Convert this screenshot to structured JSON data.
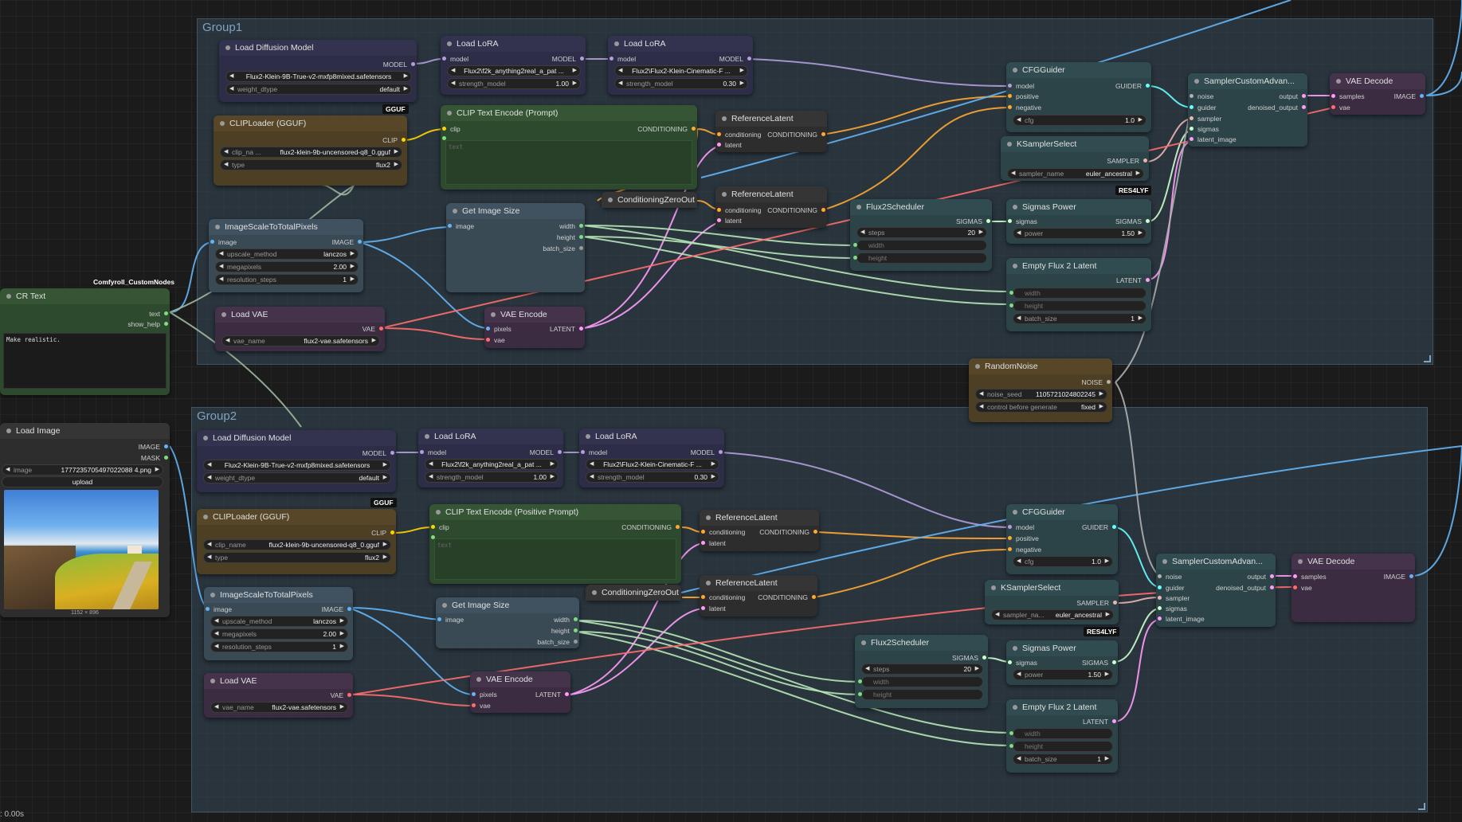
{
  "groups": {
    "g1": "Group1",
    "g2": "Group2"
  },
  "status_text": ": 0.00s",
  "colors": {
    "model": "#b39ddb",
    "clip": "#ffd500",
    "conditioning": "#ffa931",
    "image": "#64b5f6",
    "latent": "#ff9cf9",
    "vae": "#ff6e6e",
    "sigmas": "#cdffcd",
    "noise": "#b0b0b0",
    "guider": "#66ffff",
    "sampler": "#ecb4b4",
    "int": "#b7e6b7"
  },
  "cr_text": {
    "package_label": "Comfyroll_CustomNodes",
    "title": "CR Text",
    "out_text": "text",
    "out_show_help": "show_help",
    "text_value": "Make realistic."
  },
  "load_image": {
    "title": "Load Image",
    "out_image": "IMAGE",
    "out_mask": "MASK",
    "image_label": "image",
    "image_value": "1777235705497022088 4.png",
    "upload_label": "upload",
    "dims": "1152 × 896"
  },
  "g1": {
    "diffusion": {
      "title": "Load Diffusion Model",
      "out": "MODEL",
      "unet": "Flux2-Klein-9B-True-v2-mxfp8mixed.safetensors",
      "dtype_label": "weight_dtype",
      "dtype_value": "default",
      "badge": "GGUF"
    },
    "lora1": {
      "title": "Load LoRA",
      "in": "model",
      "out": "MODEL",
      "name": "Flux2\\f2k_anything2real_a_pat ...",
      "str_label": "strength_model",
      "str_value": "1.00"
    },
    "lora2": {
      "title": "Load LoRA",
      "in": "model",
      "out": "MODEL",
      "name": "Flux2\\Flux2-Klein-Cinematic-F ...",
      "str_label": "strength_model",
      "str_value": "0.30"
    },
    "cliploader": {
      "title": "CLIPLoader (GGUF)",
      "out": "CLIP",
      "name_label": "clip_na ...",
      "name_value": "flux2-klein-9b-uncensored-q8_0.gguf",
      "type_label": "type",
      "type_value": "flux2"
    },
    "clip_encode": {
      "title": "CLIP Text Encode (Prompt)",
      "in_clip": "clip",
      "in_text": "text",
      "out": "CONDITIONING",
      "placeholder": "text"
    },
    "ref1": {
      "title": "ReferenceLatent",
      "in1": "conditioning",
      "in2": "latent",
      "out": "CONDITIONING"
    },
    "ref2": {
      "title": "ReferenceLatent",
      "in1": "conditioning",
      "in2": "latent",
      "out": "CONDITIONING"
    },
    "czo": {
      "title": "ConditioningZeroOut"
    },
    "scale": {
      "title": "ImageScaleToTotalPixels",
      "in": "image",
      "out": "IMAGE",
      "w1l": "upscale_method",
      "w1v": "lanczos",
      "w2l": "megapixels",
      "w2v": "2.00",
      "w3l": "resolution_steps",
      "w3v": "1"
    },
    "imgsize": {
      "title": "Get Image Size",
      "in": "image",
      "o1": "width",
      "o2": "height",
      "o3": "batch_size"
    },
    "loadvae": {
      "title": "Load VAE",
      "out": "VAE",
      "l": "vae_name",
      "v": "flux2-vae.safetensors"
    },
    "vaeenc": {
      "title": "VAE Encode",
      "in1": "pixels",
      "in2": "vae",
      "out": "LATENT"
    },
    "cfg": {
      "title": "CFGGuider",
      "in1": "model",
      "in2": "positive",
      "in3": "negative",
      "out": "GUIDER",
      "l": "cfg",
      "v": "1.0"
    },
    "ksel": {
      "title": "KSamplerSelect",
      "out": "SAMPLER",
      "l": "sampler_name",
      "v": "euler_ancestral",
      "badge": "RES4LYF"
    },
    "sched": {
      "title": "Flux2Scheduler",
      "out": "SIGMAS",
      "l1": "steps",
      "v1": "20",
      "l2": "width",
      "l3": "height"
    },
    "spow": {
      "title": "Sigmas Power",
      "in": "sigmas",
      "out": "SIGMAS",
      "l": "power",
      "v": "1.50"
    },
    "empty": {
      "title": "Empty Flux 2 Latent",
      "out": "LATENT",
      "l1": "width",
      "l2": "height",
      "l3": "batch_size",
      "v3": "1"
    },
    "sampler": {
      "title": "SamplerCustomAdvan...",
      "i1": "noise",
      "i2": "guider",
      "i3": "sampler",
      "i4": "sigmas",
      "i5": "latent_image",
      "o1": "output",
      "o2": "denoised_output"
    },
    "decode": {
      "title": "VAE Decode",
      "i1": "samples",
      "i2": "vae",
      "out": "IMAGE"
    }
  },
  "noise": {
    "title": "RandomNoise",
    "out": "NOISE",
    "l1": "noise_seed",
    "v1": "1105721024802245",
    "l2": "control before generate",
    "v2": "fixed"
  },
  "g2": {
    "diffusion": {
      "title": "Load Diffusion Model",
      "out": "MODEL",
      "unet": "Flux2-Klein-9B-True-v2-mxfp8mixed.safetensors",
      "dtype_label": "weight_dtype",
      "dtype_value": "default",
      "badge": "GGUF"
    },
    "lora1": {
      "title": "Load LoRA",
      "in": "model",
      "out": "MODEL",
      "name": "Flux2\\f2k_anything2real_a_pat ...",
      "str_label": "strength_model",
      "str_value": "1.00"
    },
    "lora2": {
      "title": "Load LoRA",
      "in": "model",
      "out": "MODEL",
      "name": "Flux2\\Flux2-Klein-Cinematic-F ...",
      "str_label": "strength_model",
      "str_value": "0.30"
    },
    "cliploader": {
      "title": "CLIPLoader (GGUF)",
      "out": "CLIP",
      "name_label": "clip_name",
      "name_value": "flux2-klein-9b-uncensored-q8_0.gguf",
      "type_label": "type",
      "type_value": "flux2"
    },
    "clip_encode": {
      "title": "CLIP Text Encode (Positive Prompt)",
      "in_clip": "clip",
      "in_text": "text",
      "out": "CONDITIONING",
      "placeholder": "text"
    },
    "ref1": {
      "title": "ReferenceLatent",
      "in1": "conditioning",
      "in2": "latent",
      "out": "CONDITIONING"
    },
    "ref2": {
      "title": "ReferenceLatent",
      "in1": "conditioning",
      "in2": "latent",
      "out": "CONDITIONING"
    },
    "czo": {
      "title": "ConditioningZeroOut"
    },
    "scale": {
      "title": "ImageScaleToTotalPixels",
      "in": "image",
      "out": "IMAGE",
      "w1l": "upscale_method",
      "w1v": "lanczos",
      "w2l": "megapixels",
      "w2v": "2.00",
      "w3l": "resolution_steps",
      "w3v": "1"
    },
    "imgsize": {
      "title": "Get Image Size",
      "in": "image",
      "o1": "width",
      "o2": "height",
      "o3": "batch_size"
    },
    "loadvae": {
      "title": "Load VAE",
      "out": "VAE",
      "l": "vae_name",
      "v": "flux2-vae.safetensors"
    },
    "vaeenc": {
      "title": "VAE Encode",
      "in1": "pixels",
      "in2": "vae",
      "out": "LATENT"
    },
    "cfg": {
      "title": "CFGGuider",
      "in1": "model",
      "in2": "positive",
      "in3": "negative",
      "out": "GUIDER",
      "l": "cfg",
      "v": "1.0"
    },
    "ksel": {
      "title": "KSamplerSelect",
      "out": "SAMPLER",
      "l": "sampler_na...",
      "v": "euler_ancestral",
      "badge": "RES4LYF"
    },
    "sched": {
      "title": "Flux2Scheduler",
      "out": "SIGMAS",
      "l1": "steps",
      "v1": "20",
      "l2": "width",
      "l3": "height"
    },
    "spow": {
      "title": "Sigmas Power",
      "in": "sigmas",
      "out": "SIGMAS",
      "l": "power",
      "v": "1.50"
    },
    "empty": {
      "title": "Empty Flux 2 Latent",
      "out": "LATENT",
      "l1": "width",
      "l2": "height",
      "l3": "batch_size",
      "v3": "1"
    },
    "sampler": {
      "title": "SamplerCustomAdvan...",
      "i1": "noise",
      "i2": "guider",
      "i3": "sampler",
      "i4": "sigmas",
      "i5": "latent_image",
      "o1": "output",
      "o2": "denoised_output"
    },
    "decode": {
      "title": "VAE Decode",
      "i1": "samples",
      "i2": "vae",
      "out": "IMAGE"
    }
  }
}
